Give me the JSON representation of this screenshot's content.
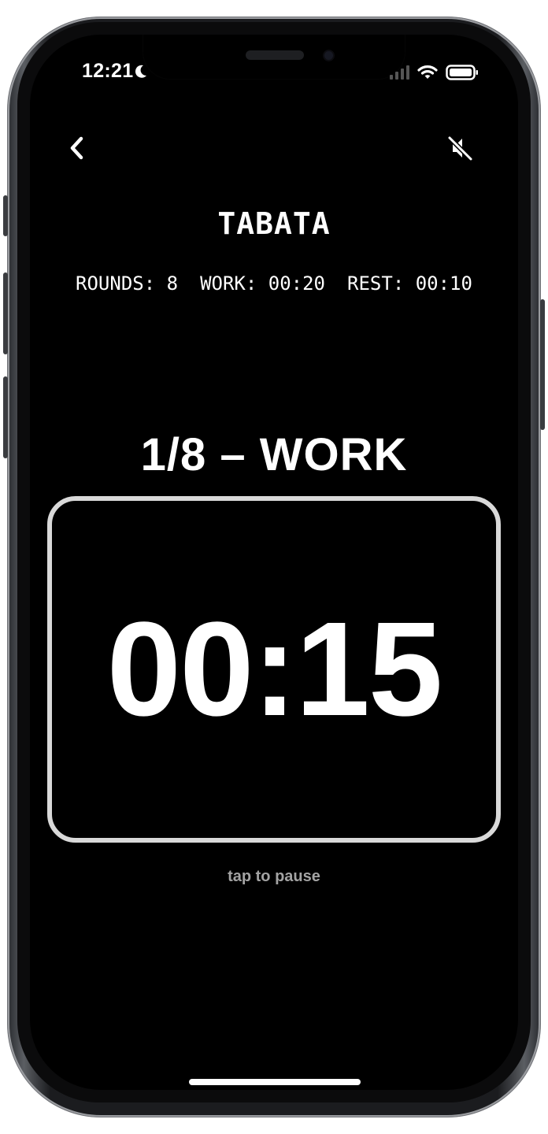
{
  "status_bar": {
    "time": "12:21"
  },
  "workout": {
    "title": "TABATA",
    "rounds_label": "ROUNDS: 8",
    "work_label": "WORK: 00:20",
    "rest_label": "REST: 00:10",
    "phase": "1/8 – WORK",
    "timer": "00:15",
    "hint": "tap to pause"
  },
  "icons": {
    "back": "chevron-left-icon",
    "mute": "speaker-muted-icon",
    "moon": "moon-icon",
    "signal": "signal-icon",
    "wifi": "wifi-icon",
    "battery": "battery-icon"
  },
  "colors": {
    "screen_bg": "#000000",
    "text": "#ffffff",
    "hint": "#a3a3a3",
    "timer_border": "#d9d9d9"
  }
}
